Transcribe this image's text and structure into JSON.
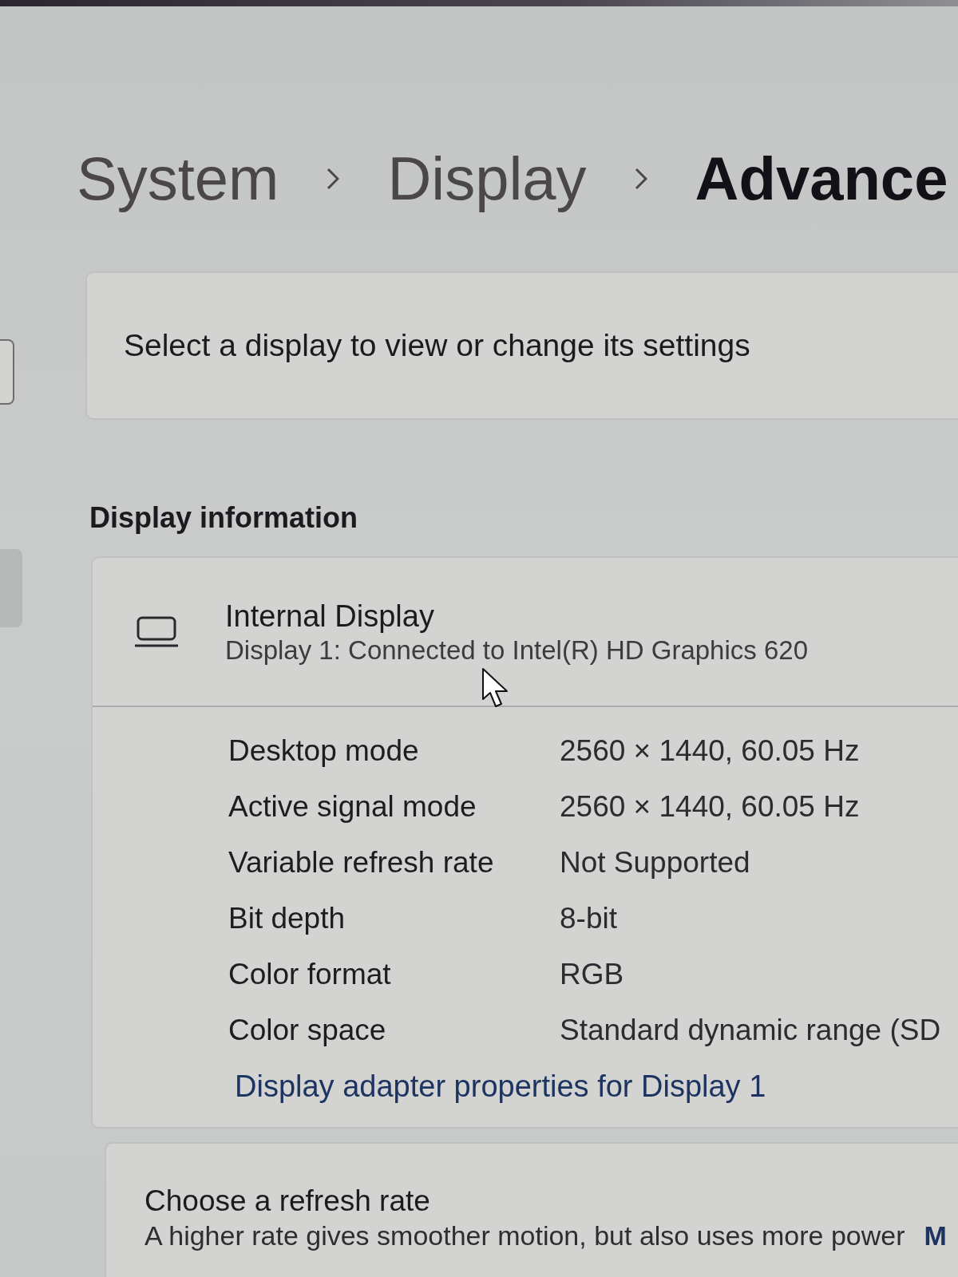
{
  "breadcrumb": [
    {
      "label": "System",
      "current": false
    },
    {
      "label": "Display",
      "current": false
    },
    {
      "label": "Advance",
      "current": true
    }
  ],
  "display_picker": {
    "prompt": "Select a display to view or change its settings"
  },
  "display_information": {
    "heading": "Display information",
    "display": {
      "name": "Internal Display",
      "description": "Display 1: Connected to Intel(R) HD Graphics 620"
    },
    "properties": [
      {
        "label": "Desktop mode",
        "value": "2560 × 1440, 60.05 Hz"
      },
      {
        "label": "Active signal mode",
        "value": "2560 × 1440, 60.05 Hz"
      },
      {
        "label": "Variable refresh rate",
        "value": "Not Supported"
      },
      {
        "label": "Bit depth",
        "value": "8-bit"
      },
      {
        "label": "Color format",
        "value": "RGB"
      },
      {
        "label": "Color space",
        "value": "Standard dynamic range (SD"
      }
    ],
    "link": "Display adapter properties for Display 1"
  },
  "refresh_rate": {
    "title": "Choose a refresh rate",
    "description": "A higher rate gives smoother motion, but also uses more power",
    "link": "M"
  }
}
